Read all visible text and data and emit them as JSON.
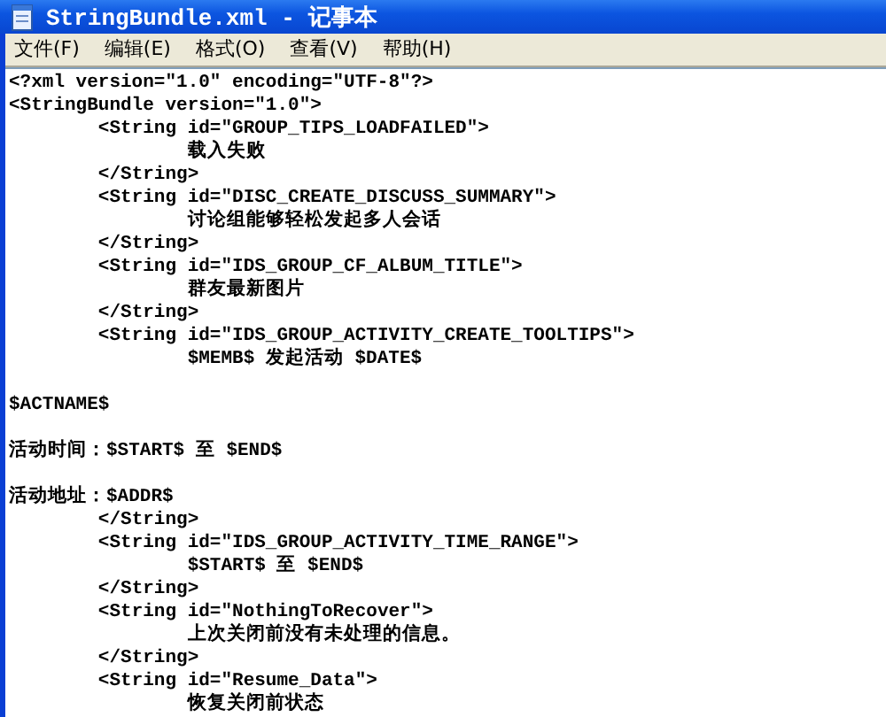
{
  "window": {
    "title": "StringBundle.xml - 记事本"
  },
  "menu": [
    "文件(F)",
    "编辑(E)",
    "格式(O)",
    "查看(V)",
    "帮助(H)"
  ],
  "editor": {
    "blocks": [
      [
        "<?xml version=\"1.0\" encoding=\"UTF-8\"?>",
        "<StringBundle version=\"1.0\">",
        "\t<String id=\"GROUP_TIPS_LOADFAILED\">",
        "\t\t载入失败",
        "\t</String>",
        "\t<String id=\"DISC_CREATE_DISCUSS_SUMMARY\">",
        "\t\t讨论组能够轻松发起多人会话",
        "\t</String>",
        "\t<String id=\"IDS_GROUP_CF_ALBUM_TITLE\">",
        "\t\t群友最新图片",
        "\t</String>",
        "\t<String id=\"IDS_GROUP_ACTIVITY_CREATE_TOOLTIPS\">",
        "\t\t$MEMB$ 发起活动 $DATE$"
      ],
      [
        "$ACTNAME$"
      ],
      [
        "活动时间：$START$ 至 $END$"
      ],
      [
        "活动地址：$ADDR$",
        "\t</String>",
        "\t<String id=\"IDS_GROUP_ACTIVITY_TIME_RANGE\">",
        "\t\t$START$ 至 $END$",
        "\t</String>",
        "\t<String id=\"NothingToRecover\">",
        "\t\t上次关闭前没有未处理的信息。",
        "\t</String>",
        "\t<String id=\"Resume_Data\">",
        "\t\t恢复关闭前状态"
      ]
    ]
  }
}
